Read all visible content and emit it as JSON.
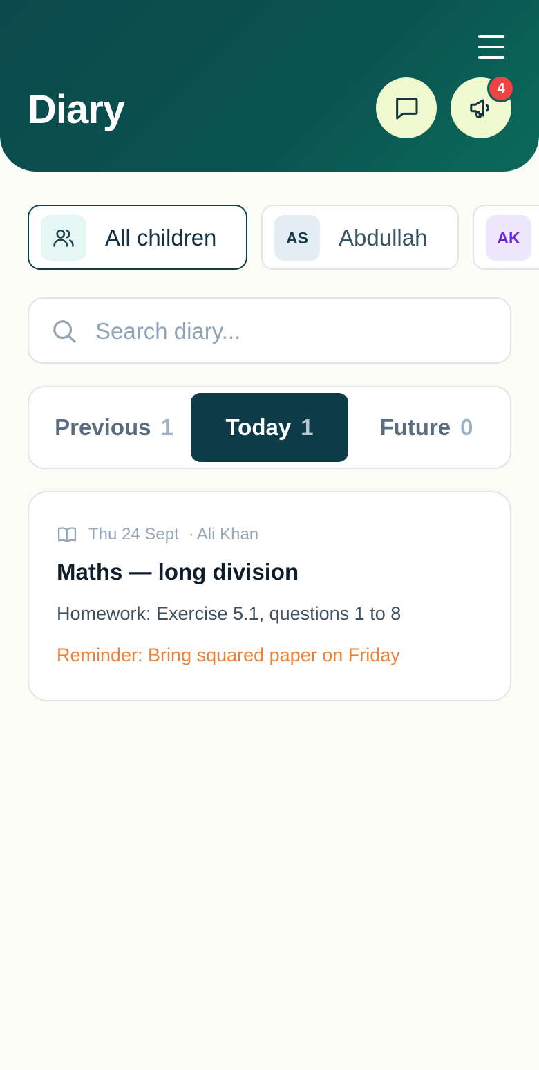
{
  "header": {
    "title": "Diary",
    "menu_icon": "hamburger-menu-icon",
    "messages_icon": "message-bubble-icon",
    "announcements_icon": "megaphone-icon",
    "notification_count": "4",
    "gradient_start": "#0b4a4c",
    "gradient_end": "#0b6b5a"
  },
  "children": {
    "items": [
      {
        "label": "All children",
        "icon": "people-group-icon"
      },
      {
        "label": "Abdullah",
        "initials": "AS"
      },
      {
        "label": "",
        "initials": "AK"
      }
    ]
  },
  "search": {
    "placeholder": "Search diary...",
    "value": "",
    "icon": "search-icon"
  },
  "tabs": [
    {
      "label": "Previous",
      "count": "1"
    },
    {
      "label": "Today",
      "count": "1"
    },
    {
      "label": "Future",
      "count": "0"
    }
  ],
  "entries": [
    {
      "icon": "open-book-icon",
      "date": "Thu 24 Sept",
      "separator": "·",
      "teacher": "Ali Khan",
      "title": "Maths — long division",
      "body": "Homework: Exercise 5.1, questions 1 to 8",
      "reminder": "Reminder: Bring squared paper on Friday"
    }
  ],
  "colors": {
    "accent_dark": "#0d3b48",
    "badge_red": "#ef4444",
    "reminder_orange": "#e8823c",
    "button_cream": "#f0f9d0"
  }
}
